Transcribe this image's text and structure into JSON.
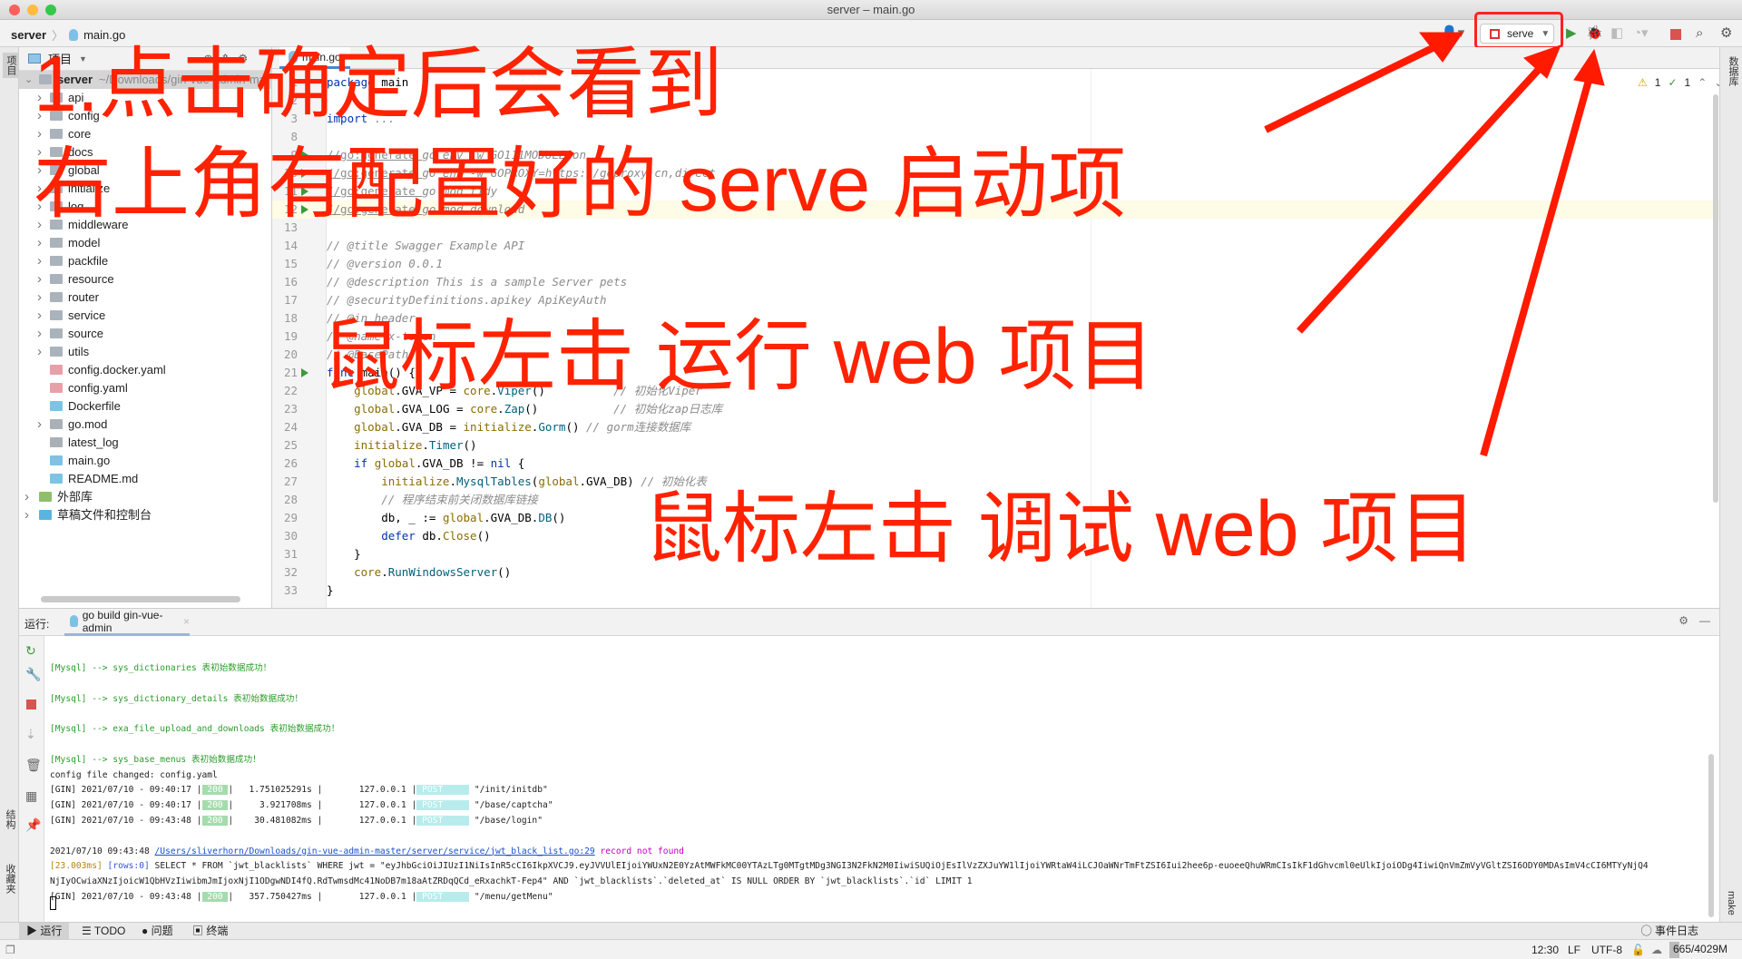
{
  "window": {
    "title": "server – main.go"
  },
  "breadcrumb": {
    "root": "server",
    "file": "main.go"
  },
  "toolbar": {
    "run_config": "serve",
    "icons": [
      "user-icon",
      "run-icon",
      "debug-icon",
      "coverage-icon",
      "profile-icon",
      "stop-icon",
      "search-icon",
      "gear-icon"
    ]
  },
  "left_strip": {
    "project": "项目",
    "structure": "结构",
    "favorites": "收藏夹"
  },
  "right_strip": {
    "database": "数据库",
    "make": "make"
  },
  "project": {
    "header": "项目",
    "root": {
      "name": "server",
      "path": "~/Downloads/gin-vue-admin-ma"
    },
    "items": [
      {
        "name": "api",
        "type": "folder"
      },
      {
        "name": "config",
        "type": "folder"
      },
      {
        "name": "core",
        "type": "folder"
      },
      {
        "name": "docs",
        "type": "folder"
      },
      {
        "name": "global",
        "type": "folder"
      },
      {
        "name": "initialize",
        "type": "folder"
      },
      {
        "name": "log",
        "type": "folder"
      },
      {
        "name": "middleware",
        "type": "folder"
      },
      {
        "name": "model",
        "type": "folder"
      },
      {
        "name": "packfile",
        "type": "folder"
      },
      {
        "name": "resource",
        "type": "folder"
      },
      {
        "name": "router",
        "type": "folder"
      },
      {
        "name": "service",
        "type": "folder"
      },
      {
        "name": "source",
        "type": "folder"
      },
      {
        "name": "utils",
        "type": "folder"
      },
      {
        "name": "config.docker.yaml",
        "type": "yaml"
      },
      {
        "name": "config.yaml",
        "type": "yaml"
      },
      {
        "name": "Dockerfile",
        "type": "docker"
      },
      {
        "name": "go.mod",
        "type": "mod"
      },
      {
        "name": "latest_log",
        "type": "log"
      },
      {
        "name": "main.go",
        "type": "go"
      },
      {
        "name": "README.md",
        "type": "md"
      }
    ],
    "external": "外部库",
    "scratches": "草稿文件和控制台"
  },
  "editor": {
    "tab": "main.go",
    "inspections": {
      "warnings": "1",
      "ok": "1"
    },
    "lines": [
      {
        "n": "1",
        "seg": [
          [
            "package ",
            "k"
          ],
          [
            "main",
            "p"
          ]
        ]
      },
      {
        "n": "2",
        "seg": []
      },
      {
        "n": "3",
        "seg": [
          [
            "import ",
            "k"
          ],
          [
            "...",
            "c"
          ]
        ]
      },
      {
        "n": "8",
        "seg": []
      },
      {
        "n": "9",
        "run": true,
        "seg": [
          [
            "//go:generate ",
            "cu"
          ],
          [
            "go env -w GO111MODULE=on",
            "c"
          ]
        ]
      },
      {
        "n": "10",
        "run": true,
        "seg": [
          [
            "//go:generate ",
            "cu"
          ],
          [
            "go env -w GOPROXY=https://goproxy.cn,direct",
            "c"
          ]
        ]
      },
      {
        "n": "11",
        "run": true,
        "seg": [
          [
            "//go:generate ",
            "cu"
          ],
          [
            "go mod tidy",
            "c"
          ]
        ]
      },
      {
        "n": "12",
        "run": true,
        "hl": true,
        "seg": [
          [
            "//go:generate ",
            "cu"
          ],
          [
            "go mod download",
            "c"
          ]
        ]
      },
      {
        "n": "13",
        "seg": []
      },
      {
        "n": "14",
        "seg": [
          [
            "// @title Swagger Example API",
            "c"
          ]
        ]
      },
      {
        "n": "15",
        "seg": [
          [
            "// @version 0.0.1",
            "c"
          ]
        ]
      },
      {
        "n": "16",
        "seg": [
          [
            "// @description This is a sample Server pets",
            "c"
          ]
        ]
      },
      {
        "n": "17",
        "seg": [
          [
            "// @securityDefinitions.apikey ApiKeyAuth",
            "c"
          ]
        ]
      },
      {
        "n": "18",
        "seg": [
          [
            "// @in header",
            "c"
          ]
        ]
      },
      {
        "n": "19",
        "seg": [
          [
            "// @name x-token",
            "c"
          ]
        ]
      },
      {
        "n": "20",
        "seg": [
          [
            "// @BasePath /",
            "c"
          ]
        ]
      },
      {
        "n": "21",
        "run": true,
        "seg": [
          [
            "func ",
            "k"
          ],
          [
            "main() {",
            "p"
          ]
        ]
      },
      {
        "n": "22",
        "seg": [
          [
            "    global",
            "g"
          ],
          [
            ".GVA_VP = ",
            "p"
          ],
          [
            "core",
            "g"
          ],
          [
            ".",
            "p"
          ],
          [
            "Viper",
            "f"
          ],
          [
            "()          ",
            "p"
          ],
          [
            "// 初始化Viper",
            "c"
          ]
        ]
      },
      {
        "n": "23",
        "seg": [
          [
            "    global",
            "g"
          ],
          [
            ".GVA_LOG = ",
            "p"
          ],
          [
            "core",
            "g"
          ],
          [
            ".",
            "p"
          ],
          [
            "Zap",
            "f"
          ],
          [
            "()           ",
            "p"
          ],
          [
            "// 初始化zap日志库",
            "c"
          ]
        ]
      },
      {
        "n": "24",
        "seg": [
          [
            "    global",
            "g"
          ],
          [
            ".GVA_DB = ",
            "p"
          ],
          [
            "initialize",
            "g"
          ],
          [
            ".",
            "p"
          ],
          [
            "Gorm",
            "f"
          ],
          [
            "() ",
            "p"
          ],
          [
            "// gorm连接数据库",
            "c"
          ]
        ]
      },
      {
        "n": "25",
        "seg": [
          [
            "    initialize",
            "g"
          ],
          [
            ".",
            "p"
          ],
          [
            "Timer",
            "f"
          ],
          [
            "()",
            "p"
          ]
        ]
      },
      {
        "n": "26",
        "seg": [
          [
            "    if ",
            "k"
          ],
          [
            "global",
            "g"
          ],
          [
            ".GVA_DB != ",
            "p"
          ],
          [
            "nil",
            "k"
          ],
          [
            " {",
            "p"
          ]
        ]
      },
      {
        "n": "27",
        "seg": [
          [
            "        initialize",
            "g"
          ],
          [
            ".",
            "p"
          ],
          [
            "MysqlTables",
            "f"
          ],
          [
            "(",
            "p"
          ],
          [
            "global",
            "g"
          ],
          [
            ".GVA_DB) ",
            "p"
          ],
          [
            "// 初始化表",
            "c"
          ]
        ]
      },
      {
        "n": "28",
        "seg": [
          [
            "        // 程序结束前关闭数据库链接",
            "c"
          ]
        ]
      },
      {
        "n": "29",
        "seg": [
          [
            "        db, _ := ",
            "p"
          ],
          [
            "global",
            "g"
          ],
          [
            ".GVA_DB.",
            "p"
          ],
          [
            "DB",
            "f"
          ],
          [
            "()",
            "p"
          ]
        ]
      },
      {
        "n": "30",
        "seg": [
          [
            "        defer ",
            "k"
          ],
          [
            "db.",
            "p"
          ],
          [
            "Close",
            "g"
          ],
          [
            "()",
            "p"
          ]
        ]
      },
      {
        "n": "31",
        "seg": [
          [
            "    }",
            "p"
          ]
        ]
      },
      {
        "n": "32",
        "seg": [
          [
            "    core",
            "g"
          ],
          [
            ".",
            "p"
          ],
          [
            "RunWindowsServer",
            "f"
          ],
          [
            "()",
            "p"
          ]
        ]
      },
      {
        "n": "33",
        "seg": [
          [
            "}",
            "p"
          ]
        ]
      }
    ]
  },
  "run_panel": {
    "label": "运行:",
    "tab": "go build gin-vue-admin",
    "console": [
      [
        [
          "[Mysql] --> sys_dictionaries 表初始数据成功！",
          "grn"
        ]
      ],
      [],
      [
        [
          "[Mysql] --> sys_dictionary_details 表初始数据成功！",
          "grn"
        ]
      ],
      [],
      [
        [
          "[Mysql] --> exa_file_upload_and_downloads 表初始数据成功！",
          "grn"
        ]
      ],
      [],
      [
        [
          "[Mysql] --> sys_base_menus 表初始数据成功！",
          "grn"
        ]
      ],
      [
        [
          "config file changed: config.yaml",
          ""
        ]
      ],
      [
        [
          "[GIN] 2021/07/10 - 09:40:17 |",
          ""
        ],
        [
          " 200 ",
          "ok"
        ],
        [
          "|   1.751025291s |       127.0.0.1 |",
          ""
        ],
        [
          " POST     ",
          "post"
        ],
        [
          " \"/init/initdb\"",
          ""
        ]
      ],
      [
        [
          "[GIN] 2021/07/10 - 09:40:17 |",
          ""
        ],
        [
          " 200 ",
          "ok"
        ],
        [
          "|     3.921708ms |       127.0.0.1 |",
          ""
        ],
        [
          " POST     ",
          "post"
        ],
        [
          " \"/base/captcha\"",
          ""
        ]
      ],
      [
        [
          "[GIN] 2021/07/10 - 09:43:48 |",
          ""
        ],
        [
          " 200 ",
          "ok"
        ],
        [
          "|    30.481082ms |       127.0.0.1 |",
          ""
        ],
        [
          " POST     ",
          "post"
        ],
        [
          " \"/base/login\"",
          ""
        ]
      ],
      [],
      [
        [
          "2021/07/10 09:43:48 ",
          ""
        ],
        [
          "/Users/sliverhorn/Downloads/gin-vue-admin-master/server/service/jwt_black_list.go:29",
          "lnk"
        ],
        [
          " record not found",
          "mag"
        ]
      ],
      [
        [
          "[23.003ms] ",
          "yel"
        ],
        [
          "[rows:0]",
          "blu"
        ],
        [
          " SELECT * FROM `jwt_blacklists` WHERE jwt = \"eyJhbGciOiJIUzI1NiIsInR5cCI6IkpXVCJ9.eyJVVUlEIjoiYWUxN2E0YzAtMWFkMC00YTAzLTg0MTgtMDg3NGI3N2FkN2M0IiwiSUQiOjEsIlVzZXJuYW1lIjoiYWRtaW4iLCJOaWNrTmFtZSI6Iui2hee6p-euoeeQhuWRmCIsIkF1dGhvcml0eUlkIjoiODg4IiwiQnVmZmVyVGltZSI6ODY0MDAsImV4cCI6MTYyNjQ4",
          ""
        ]
      ],
      [
        [
          "NjIyOCwiaXNzIjoicW1QbHVzIiwibmJmIjoxNjI1ODgwNDI4fQ.RdTwmsdMc41NoDB7m18aAtZRDqQCd_eRxachkT-Fep4\" AND `jwt_blacklists`.`deleted_at` IS NULL ORDER BY `jwt_blacklists`.`id` LIMIT 1",
          ""
        ]
      ],
      [
        [
          "[GIN] 2021/07/10 - 09:43:48 |",
          ""
        ],
        [
          " 200 ",
          "ok"
        ],
        [
          "|   357.750427ms |       127.0.0.1 |",
          ""
        ],
        [
          " POST     ",
          "post"
        ],
        [
          " \"/menu/getMenu\"",
          ""
        ]
      ]
    ]
  },
  "bottom_tabs": [
    "运行",
    "TODO",
    "问题",
    "终端"
  ],
  "event_log": "事件日志",
  "status": {
    "position": "12:30",
    "line_sep": "LF",
    "encoding": "UTF-8",
    "memory": "665/4029M"
  },
  "annotations": {
    "line1": "1.点击确定后会看到",
    "line2": "右上角有配置好的 serve 启动项",
    "run": "鼠标左击 运行 web 项目",
    "debug": "鼠标左击 调试 web 项目",
    "color": "#ff2200"
  }
}
